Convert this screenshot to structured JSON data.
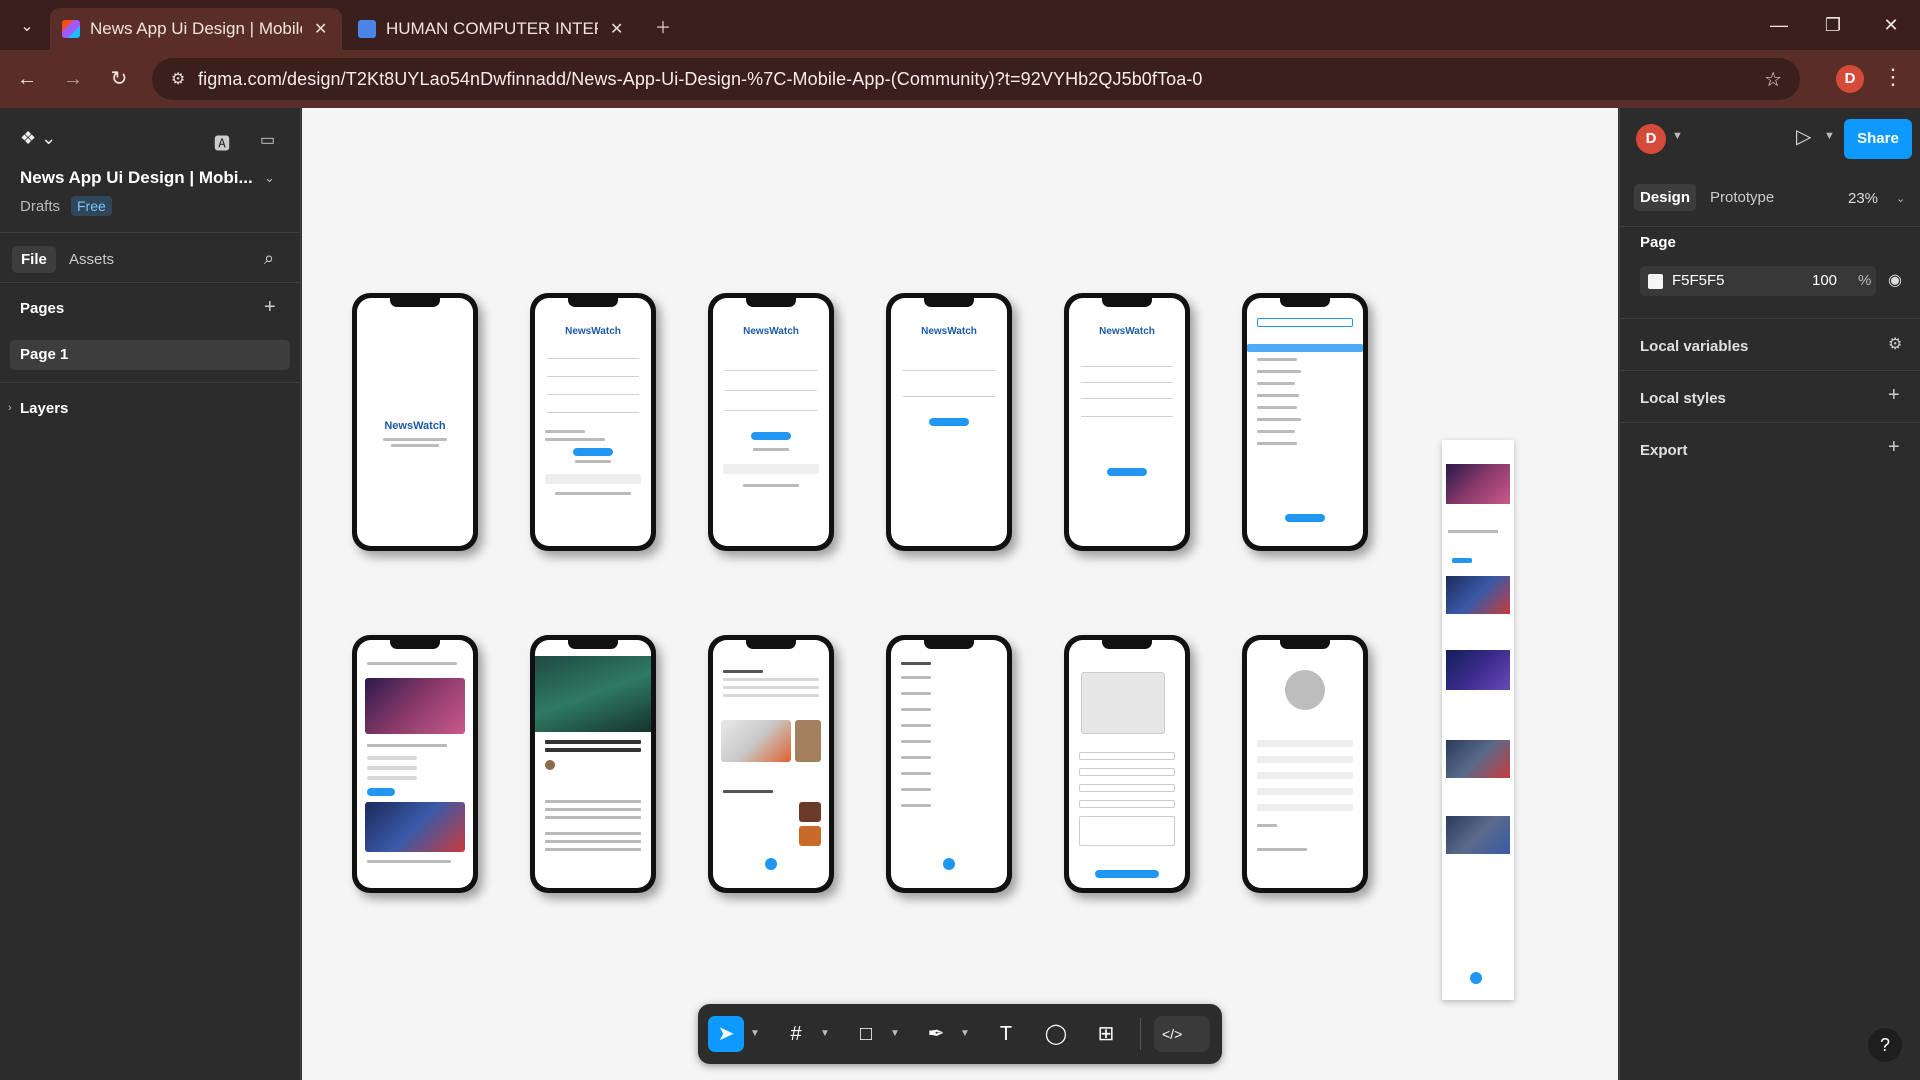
{
  "browser": {
    "tabs": [
      {
        "title": "News App Ui Design | Mobile A",
        "active": true,
        "favicon": "figma-icon"
      },
      {
        "title": "HUMAN COMPUTER INTERACT",
        "active": false,
        "favicon": "docs-icon"
      }
    ],
    "url": "figma.com/design/T2Kt8UYLao54nDwfinnadd/News-App-Ui-Design-%7C-Mobile-App-(Community)?t=92VYHb2QJ5b0fToa-0",
    "profile_initial": "D"
  },
  "left_panel": {
    "file_title": "News App Ui Design | Mobi...",
    "drafts_label": "Drafts",
    "plan_badge": "Free",
    "tabs": [
      "File",
      "Assets"
    ],
    "pages_label": "Pages",
    "pages": [
      "Page 1"
    ],
    "layers_label": "Layers"
  },
  "canvas": {
    "background": "#F5F5F5",
    "app_logo_text": "NewsWatch",
    "frame_count": 13
  },
  "toolbar": {
    "tools": [
      "move-tool",
      "frame-tool",
      "shape-tool",
      "pen-tool",
      "text-tool",
      "comment-tool",
      "actions-tool"
    ],
    "dev_mode_label": "</>"
  },
  "right_panel": {
    "avatar_initial": "D",
    "share_label": "Share",
    "tabs": [
      "Design",
      "Prototype"
    ],
    "zoom": "23%",
    "page_section": "Page",
    "page_color": "F5F5F5",
    "page_opacity": "100",
    "percent_sign": "%",
    "local_variables": "Local variables",
    "local_styles": "Local styles",
    "export": "Export",
    "help": "?"
  },
  "colors": {
    "accent": "#0d99ff",
    "chrome_dark": "#3a1f1c",
    "chrome_mid": "#5a2e28",
    "panel": "#2c2c2c",
    "app_blue": "#2196f3"
  }
}
